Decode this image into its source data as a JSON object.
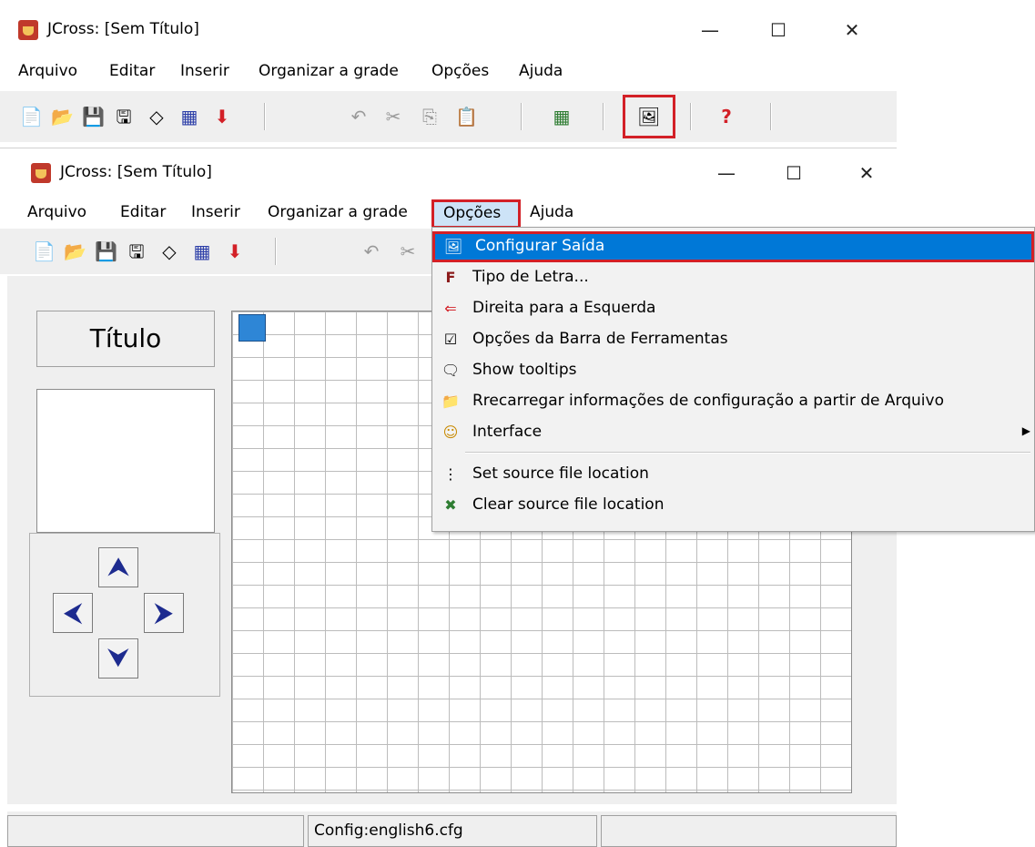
{
  "back_window": {
    "title": "JCross: [Sem Título]",
    "menu": [
      "Arquivo",
      "Editar",
      "Inserir",
      "Organizar a grade",
      "Opções",
      "Ajuda"
    ],
    "toolbar_icons": [
      "new-file-icon",
      "open-folder-icon",
      "save-icon",
      "save-as-icon",
      "eraser-icon",
      "web-page-icon",
      "export-arrow-icon",
      "undo-icon",
      "cut-icon",
      "copy-icon",
      "paste-icon",
      "grid-icon",
      "config-output-icon",
      "help-icon"
    ]
  },
  "front_window": {
    "title": "JCross: [Sem Título]",
    "controls": {
      "minimize": "—",
      "maximize": "☐",
      "close": "✕"
    },
    "menu": [
      "Arquivo",
      "Editar",
      "Inserir",
      "Organizar a grade",
      "Opções",
      "Ajuda"
    ],
    "title_button": "Título",
    "arrows": {
      "up": "⮝",
      "left": "⮜",
      "right": "⮞",
      "down": "⮟"
    },
    "status": {
      "config": "Config:english6.cfg"
    }
  },
  "dropdown": {
    "items": [
      {
        "label": "Configurar Saída",
        "icon": "config-output-icon",
        "selected": true
      },
      {
        "label": "Tipo de Letra...",
        "icon": "font-icon"
      },
      {
        "label": "Direita para a Esquerda",
        "icon": "rtl-icon"
      },
      {
        "label": "Opções da Barra de Ferramentas",
        "icon": "toolbar-options-icon"
      },
      {
        "label": "Show tooltips",
        "icon": "tooltip-icon"
      },
      {
        "label": "Rrecarregar informações de configuração a partir de Arquivo",
        "icon": "reload-icon"
      },
      {
        "label": "Interface",
        "icon": "interface-icon",
        "submenu": true
      },
      {
        "label": "Set source file location",
        "icon": "set-source-icon"
      },
      {
        "label": "Clear source file location",
        "icon": "clear-source-icon"
      }
    ],
    "submenu_arrow": "▶"
  },
  "colors": {
    "highlight": "#0078d7",
    "annotation": "#d32027",
    "arrow": "#1d2b8f"
  }
}
